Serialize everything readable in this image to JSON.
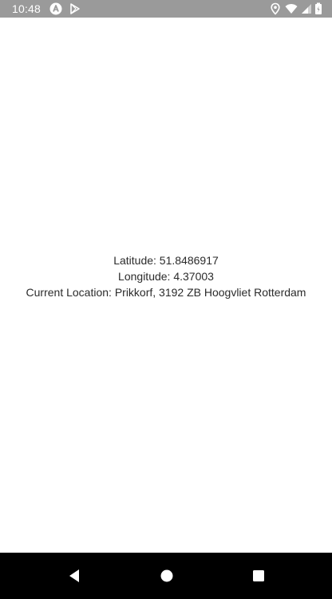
{
  "status_bar": {
    "time": "10:48",
    "icons": [
      "app-a-icon",
      "play-store-icon",
      "location-pin-icon",
      "wifi-icon",
      "signal-icon",
      "battery-icon"
    ]
  },
  "location": {
    "latitude_text": "Latitude: 51.8486917",
    "longitude_text": "Longitude: 4.37003",
    "address_text": "Current Location: Prikkorf, 3192 ZB Hoogvliet Rotterdam"
  },
  "navigation_bar": {
    "buttons": [
      "back-icon",
      "home-icon",
      "recents-icon"
    ]
  },
  "colors": {
    "status_bar_bg": "#9a9a9a",
    "nav_bar_bg": "#000000",
    "text": "#2b2b2b",
    "background": "#ffffff"
  }
}
